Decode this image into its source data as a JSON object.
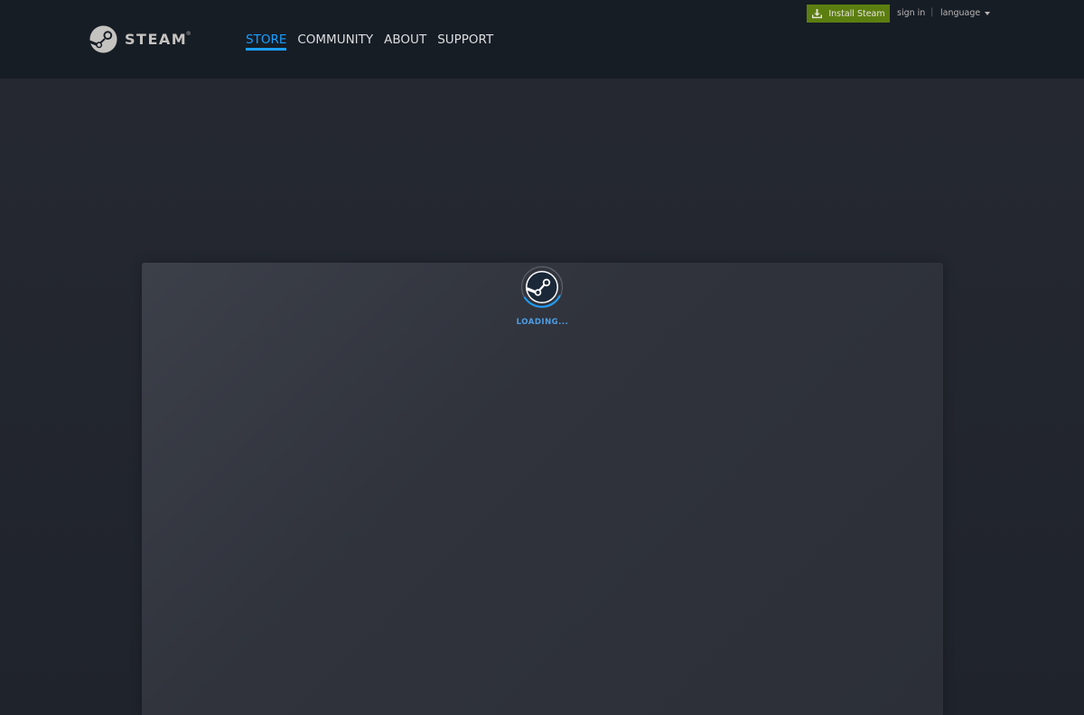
{
  "brand": {
    "logo_text": "STEAM",
    "registered_mark": "®"
  },
  "nav": {
    "items": [
      {
        "label": "STORE",
        "active": true
      },
      {
        "label": "COMMUNITY",
        "active": false
      },
      {
        "label": "ABOUT",
        "active": false
      },
      {
        "label": "SUPPORT",
        "active": false
      }
    ]
  },
  "top_bar": {
    "install_label": "Install Steam",
    "install_icon": "download-icon",
    "signin_label": "sign in",
    "separator": "|",
    "language_label": "language",
    "language_icon": "chevron-down-icon"
  },
  "content": {
    "loading_text": "LOADING...",
    "spinner_icon": "steam-logo-spinner-icon"
  },
  "colors": {
    "header_bg": "#171d25",
    "page_bg": "#1f232b",
    "active_nav": "#1a9fff",
    "install_button": "#5c7e10",
    "loading_text": "#4d9ee6"
  }
}
